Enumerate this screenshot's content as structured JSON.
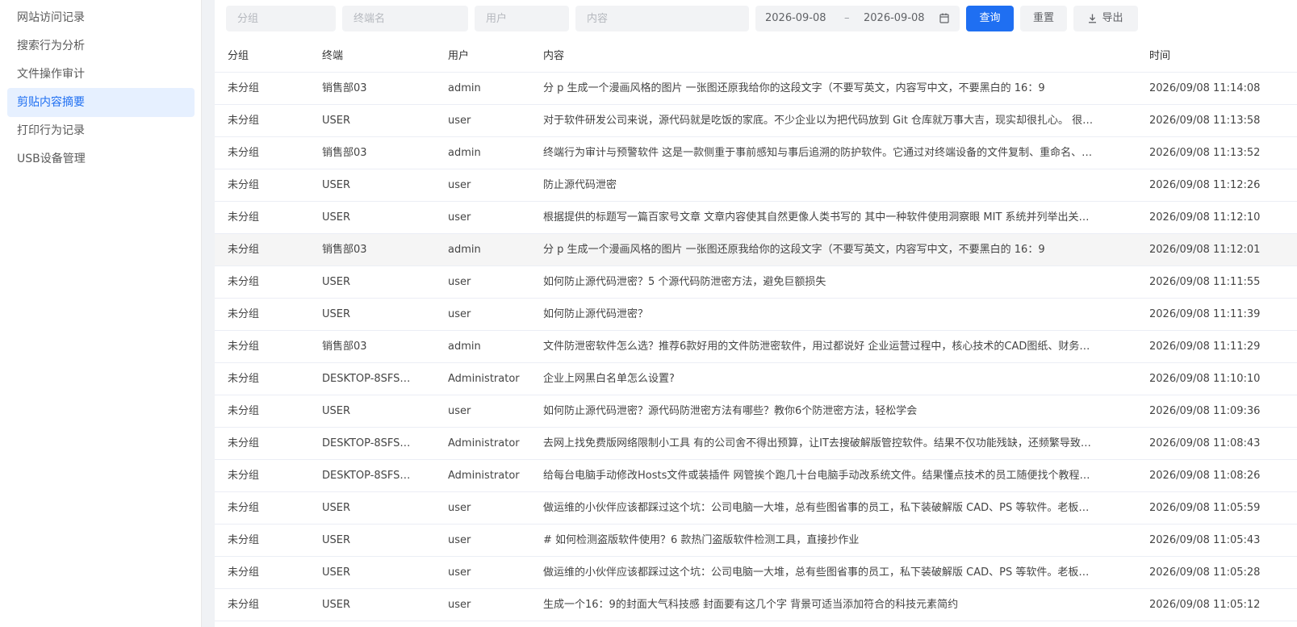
{
  "sidebar": {
    "items": [
      {
        "label": "网站访问记录",
        "active": false
      },
      {
        "label": "搜索行为分析",
        "active": false
      },
      {
        "label": "文件操作审计",
        "active": false
      },
      {
        "label": "剪贴内容摘要",
        "active": true
      },
      {
        "label": "打印行为记录",
        "active": false
      },
      {
        "label": "USB设备管理",
        "active": false
      }
    ]
  },
  "filters": {
    "group_placeholder": "分组",
    "terminal_placeholder": "终端名",
    "user_placeholder": "用户",
    "content_placeholder": "内容",
    "date_start": "2026-09-08",
    "date_separator": "–",
    "date_end": "2026-09-08",
    "query_label": "查询",
    "reset_label": "重置",
    "export_label": "导出"
  },
  "table": {
    "headers": {
      "group": "分组",
      "terminal": "终端",
      "user": "用户",
      "content": "内容",
      "time": "时间"
    },
    "rows": [
      {
        "group": "未分组",
        "terminal": "销售部03",
        "user": "admin",
        "content": "分 p 生成一个漫画风格的图片 一张图还原我给你的这段文字（不要写英文，内容写中文，不要黑白的 16：9",
        "time": "2026/09/08 11:14:08"
      },
      {
        "group": "未分组",
        "terminal": "USER",
        "user": "user",
        "content": "对于软件研发公司来说，源代码就是吃饭的家底。不少企业以为把代码放到 Git 仓库就万事大吉，现实却很扎心。 很…",
        "time": "2026/09/08 11:13:58"
      },
      {
        "group": "未分组",
        "terminal": "销售部03",
        "user": "admin",
        "content": "终端行为审计与预警软件 这是一款侧重于事前感知与事后追溯的防护软件。它通过对终端设备的文件复制、重命名、…",
        "time": "2026/09/08 11:13:52"
      },
      {
        "group": "未分组",
        "terminal": "USER",
        "user": "user",
        "content": "防止源代码泄密",
        "time": "2026/09/08 11:12:26"
      },
      {
        "group": "未分组",
        "terminal": "USER",
        "user": "user",
        "content": "根据提供的标题写一篇百家号文章 文章内容使其自然更像人类书写的 其中一种软件使用洞察眼 MIT 系统并列举出关…",
        "time": "2026/09/08 11:12:10"
      },
      {
        "group": "未分组",
        "terminal": "销售部03",
        "user": "admin",
        "content": "分 p 生成一个漫画风格的图片 一张图还原我给你的这段文字（不要写英文，内容写中文，不要黑白的 16：9",
        "time": "2026/09/08 11:12:01"
      },
      {
        "group": "未分组",
        "terminal": "USER",
        "user": "user",
        "content": "如何防止源代码泄密？5 个源代码防泄密方法，避免巨额损失",
        "time": "2026/09/08 11:11:55"
      },
      {
        "group": "未分组",
        "terminal": "USER",
        "user": "user",
        "content": "如何防止源代码泄密？",
        "time": "2026/09/08 11:11:39"
      },
      {
        "group": "未分组",
        "terminal": "销售部03",
        "user": "admin",
        "content": "文件防泄密软件怎么选？推荐6款好用的文件防泄密软件，用过都说好 企业运营过程中，核心技术的CAD图纸、财务…",
        "time": "2026/09/08 11:11:29"
      },
      {
        "group": "未分组",
        "terminal": "DESKTOP-8SFS…",
        "user": "Administrator",
        "content": "企业上网黑白名单怎么设置?",
        "time": "2026/09/08 11:10:10"
      },
      {
        "group": "未分组",
        "terminal": "USER",
        "user": "user",
        "content": "如何防止源代码泄密？源代码防泄密方法有哪些？教你6个防泄密方法，轻松学会",
        "time": "2026/09/08 11:09:36"
      },
      {
        "group": "未分组",
        "terminal": "DESKTOP-8SFS…",
        "user": "Administrator",
        "content": "去网上找免费版网络限制小工具 有的公司舍不得出预算，让IT去搜破解版管控软件。结果不仅功能残缺，还频繁导致…",
        "time": "2026/09/08 11:08:43"
      },
      {
        "group": "未分组",
        "terminal": "DESKTOP-8SFS…",
        "user": "Administrator",
        "content": "给每台电脑手动修改Hosts文件或装插件 网管挨个跑几十台电脑手动改系统文件。结果懂点技术的员工随便找个教程…",
        "time": "2026/09/08 11:08:26"
      },
      {
        "group": "未分组",
        "terminal": "USER",
        "user": "user",
        "content": "做运维的小伙伴应该都踩过这个坑：公司电脑一大堆，总有些图省事的员工，私下装破解版 CAD、PS 等软件。老板…",
        "time": "2026/09/08 11:05:59"
      },
      {
        "group": "未分组",
        "terminal": "USER",
        "user": "user",
        "content": "# 如何检测盗版软件使用？6 款热门盗版软件检测工具，直接抄作业",
        "time": "2026/09/08 11:05:43"
      },
      {
        "group": "未分组",
        "terminal": "USER",
        "user": "user",
        "content": "做运维的小伙伴应该都踩过这个坑：公司电脑一大堆，总有些图省事的员工，私下装破解版 CAD、PS 等软件。老板…",
        "time": "2026/09/08 11:05:28"
      },
      {
        "group": "未分组",
        "terminal": "USER",
        "user": "user",
        "content": "生成一个16：9的封面大气科技感 封面要有这几个字 背景可适当添加符合的科技元素简约",
        "time": "2026/09/08 11:05:12"
      }
    ],
    "highlighted_row": 5
  },
  "colors": {
    "primary": "#1f6ff2",
    "active_bg": "#e6f0ff",
    "hover_row": "#f5f5f5"
  },
  "icons": {
    "calendar": "calendar-icon",
    "export": "download-icon"
  }
}
